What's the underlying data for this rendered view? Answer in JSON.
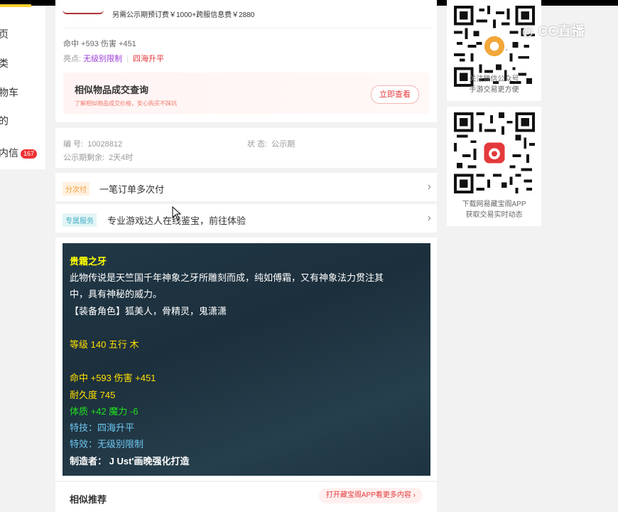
{
  "nav": {
    "items": [
      {
        "label": "页"
      },
      {
        "label": "类"
      },
      {
        "label": "物车"
      },
      {
        "label": "的"
      },
      {
        "label": "内信",
        "badge": "167"
      }
    ]
  },
  "item": {
    "fee_line": "另需公示期预订费￥1000+跨服信息费￥2880",
    "attr_line": "命中 +593 伤害 +451",
    "highlight_label": "亮点:",
    "highlight_a": "无级别限制",
    "highlight_b": "四海升平"
  },
  "similar": {
    "title": "相似物品成交查询",
    "subtitle": "了解相似物品成交价格，安心购买不踩坑",
    "button": "立即查看"
  },
  "info": {
    "number_label": "编 号:",
    "number_value": "10028812",
    "status_label": "状 态:",
    "status_value": "公示期",
    "remaining_label": "公示期剩余:",
    "remaining_value": "2天4时"
  },
  "installment": {
    "tag": "分次付",
    "text": "一笔订单多次付"
  },
  "service": {
    "tag": "专属服务",
    "text": "专业游戏达人在线鉴宝，前往体验"
  },
  "desc": {
    "name": "贵霜之牙",
    "line1": "此物传说是天竺国千年神象之牙所雕刻而成，纯如傅霜，又有神象法力贯注其",
    "line2": "中，具有神秘的威力。",
    "line3": "【装备角色】狐美人，骨精灵，鬼潇潇",
    "level": "等级 140  五行 木",
    "attr": "命中 +593 伤害 +451",
    "durability": "耐久度 745",
    "bonus": "体质 +42 魔力 -6",
    "skill": "特技：四海升平",
    "effect": "特效：无级别限制",
    "maker": "制造者：  J Ust'画晚强化打造"
  },
  "recommend": {
    "title": "相似推荐",
    "app_link": "打开藏宝阁APP看更多内容"
  },
  "sidebar": {
    "qr1_caption_1": "关注微信公众号",
    "qr1_caption_2": "手游交易更方便",
    "qr2_caption_1": "下载网易藏宝阁APP",
    "qr2_caption_2": "获取交易实时动态",
    "watermark": "CC直播"
  },
  "colors": {
    "accent_red": "#e4393c",
    "dark_panel": "#213847"
  }
}
